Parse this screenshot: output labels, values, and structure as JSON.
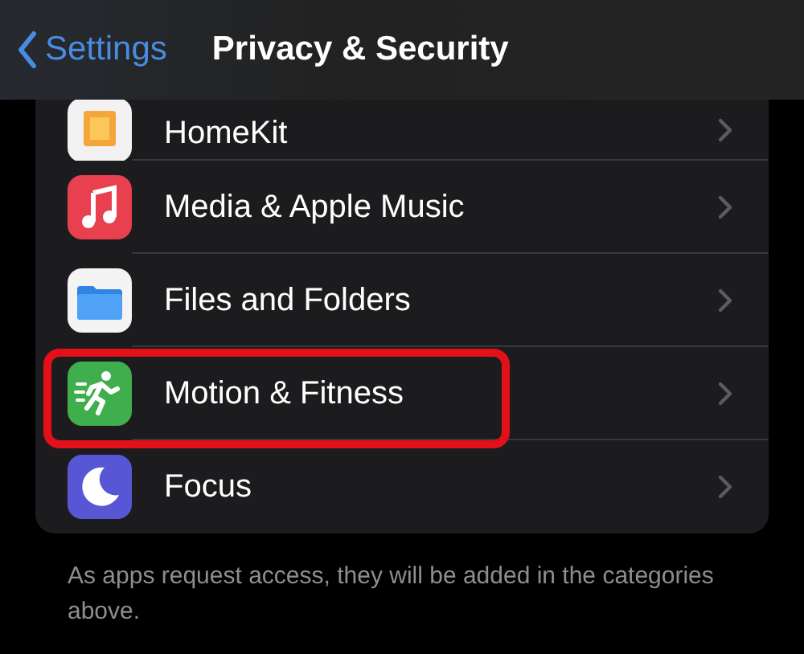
{
  "nav": {
    "back_label": "Settings",
    "title": "Privacy & Security"
  },
  "items": [
    {
      "kind": "homekit",
      "label": "HomeKit",
      "highlighted": false
    },
    {
      "kind": "music",
      "label": "Media & Apple Music",
      "highlighted": false
    },
    {
      "kind": "files",
      "label": "Files and Folders",
      "highlighted": false
    },
    {
      "kind": "motion",
      "label": "Motion & Fitness",
      "highlighted": true
    },
    {
      "kind": "focus",
      "label": "Focus",
      "highlighted": false
    }
  ],
  "footer": "As apps request access, they will be added in the categories above."
}
